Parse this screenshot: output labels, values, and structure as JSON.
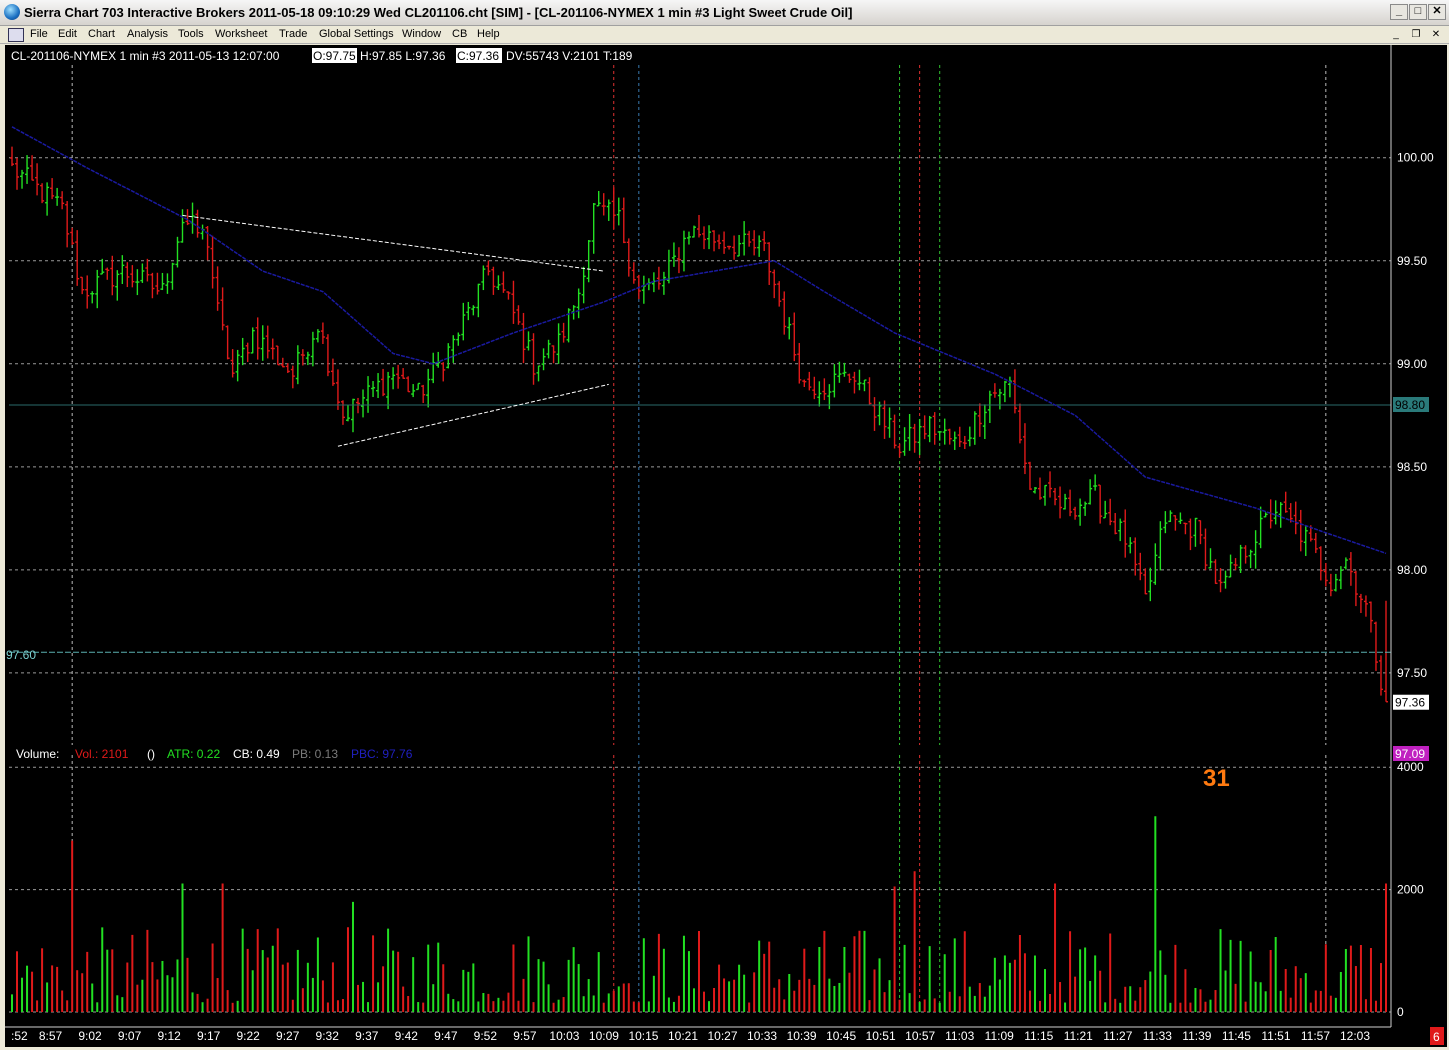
{
  "window": {
    "title": "Sierra Chart 703 Interactive Brokers 2011-05-18  09:10:29  Wed    CL201106.cht [SIM] - [CL-201106-NYMEX  1 min  #3  Light Sweet Crude Oil]",
    "minimize": "_",
    "maximize": "□",
    "close": "✕",
    "doc_minimize": "_",
    "doc_restore": "❐",
    "doc_close": "✕"
  },
  "menu": {
    "items": [
      "File",
      "Edit",
      "Chart",
      "Analysis",
      "Tools",
      "Worksheet",
      "Trade",
      "Global Settings",
      "Window",
      "CB",
      "Help"
    ]
  },
  "chart_header": {
    "symbol": "CL-201106-NYMEX  1 min  #3 2011-05-13 12:07:00",
    "open": "O:97.75",
    "high_low": "H:97.85 L:97.36",
    "close": "C:97.36",
    "stats": "DV:55743 V:2101 T:189"
  },
  "volume_header": {
    "label": "Volume:",
    "vol": "Vol.: 2101",
    "paren": "()",
    "atr": "ATR: 0.22",
    "cb": "CB: 0.49",
    "pb": "PB: 0.13",
    "pbc": "PBC: 97.76"
  },
  "colors": {
    "up_bar": "#22e022",
    "down_bar": "#e01a1a",
    "moving_average": "#1a1aa0",
    "grid": "#9a9a9a",
    "price_marker_bg": "#2a7a7a",
    "last_price_bg": "#ffffff",
    "pbc_marker_bg": "#c020c0",
    "counter_color": "#ff7a10"
  },
  "annotations": {
    "left_price_label": "97.60",
    "counter": "31",
    "bottom_right_badge": "6"
  },
  "chart_data": {
    "type": "candlestick",
    "title": "",
    "price_axis": {
      "ticks": [
        "100.00",
        "99.50",
        "99.00",
        "98.50",
        "98.00",
        "97.50"
      ],
      "range": [
        97.15,
        100.45
      ]
    },
    "price_markers": {
      "horizontal_line": "98.80",
      "last_price": "97.36",
      "pbc": "97.09"
    },
    "volume_axis": {
      "ticks": [
        "4000",
        "2000",
        "0"
      ],
      "range": [
        0,
        4200
      ]
    },
    "time_axis": {
      "ticks": [
        ":52",
        "8:57",
        "9:02",
        "9:07",
        "9:12",
        "9:17",
        "9:22",
        "9:27",
        "9:32",
        "9:37",
        "9:42",
        "9:47",
        "9:52",
        "9:57",
        "10:03",
        "10:09",
        "10:15",
        "10:21",
        "10:27",
        "10:33",
        "10:39",
        "10:45",
        "10:51",
        "10:57",
        "11:03",
        "11:09",
        "11:15",
        "11:21",
        "11:27",
        "11:33",
        "11:39",
        "11:45",
        "11:51",
        "11:57",
        "12:03"
      ]
    },
    "keypoints_close": [
      [
        0,
        99.95
      ],
      [
        10,
        99.75
      ],
      [
        14,
        99.35
      ],
      [
        22,
        99.45
      ],
      [
        30,
        99.35
      ],
      [
        34,
        99.7
      ],
      [
        39,
        99.6
      ],
      [
        41,
        99.25
      ],
      [
        44,
        98.95
      ],
      [
        48,
        99.15
      ],
      [
        56,
        98.95
      ],
      [
        61,
        99.2
      ],
      [
        66,
        98.75
      ],
      [
        71,
        98.85
      ],
      [
        76,
        98.95
      ],
      [
        81,
        98.85
      ],
      [
        88,
        99.1
      ],
      [
        95,
        99.45
      ],
      [
        99,
        99.3
      ],
      [
        104,
        99.0
      ],
      [
        109,
        99.1
      ],
      [
        113,
        99.35
      ],
      [
        116,
        99.75
      ],
      [
        121,
        99.7
      ],
      [
        125,
        99.35
      ],
      [
        130,
        99.4
      ],
      [
        135,
        99.65
      ],
      [
        141,
        99.6
      ],
      [
        150,
        99.55
      ],
      [
        158,
        98.9
      ],
      [
        162,
        98.9
      ],
      [
        168,
        98.95
      ],
      [
        173,
        98.75
      ],
      [
        177,
        98.6
      ],
      [
        183,
        98.7
      ],
      [
        189,
        98.6
      ],
      [
        195,
        98.85
      ],
      [
        199,
        98.9
      ],
      [
        203,
        98.4
      ],
      [
        210,
        98.3
      ],
      [
        216,
        98.35
      ],
      [
        222,
        98.15
      ],
      [
        226,
        97.85
      ],
      [
        230,
        98.25
      ],
      [
        236,
        98.2
      ],
      [
        241,
        97.9
      ],
      [
        246,
        98.1
      ],
      [
        252,
        98.3
      ],
      [
        258,
        98.15
      ],
      [
        263,
        97.95
      ],
      [
        266,
        98.05
      ],
      [
        270,
        97.82
      ],
      [
        274,
        97.36
      ]
    ],
    "keypoints_ma": [
      [
        0,
        100.15
      ],
      [
        15,
        99.95
      ],
      [
        35,
        99.7
      ],
      [
        50,
        99.45
      ],
      [
        62,
        99.35
      ],
      [
        76,
        99.05
      ],
      [
        84,
        99.0
      ],
      [
        100,
        99.15
      ],
      [
        118,
        99.3
      ],
      [
        128,
        99.4
      ],
      [
        140,
        99.45
      ],
      [
        152,
        99.5
      ],
      [
        162,
        99.35
      ],
      [
        176,
        99.15
      ],
      [
        196,
        98.95
      ],
      [
        212,
        98.75
      ],
      [
        226,
        98.45
      ],
      [
        248,
        98.3
      ],
      [
        262,
        98.18
      ],
      [
        274,
        98.08
      ]
    ],
    "volume_spikes": [
      [
        12,
        2800
      ],
      [
        34,
        2100
      ],
      [
        42,
        2100
      ],
      [
        68,
        1800
      ],
      [
        176,
        2050
      ],
      [
        180,
        2300
      ],
      [
        208,
        2100
      ],
      [
        228,
        3200
      ],
      [
        274,
        2101
      ]
    ],
    "lines": [
      {
        "kind": "trendline",
        "from": [
          34,
          99.72
        ],
        "to": [
          118,
          99.45
        ]
      },
      {
        "kind": "trendline",
        "from": [
          65,
          98.6
        ],
        "to": [
          119,
          98.9
        ]
      }
    ],
    "vertical_markers": [
      {
        "bar": 120,
        "color": "red"
      },
      {
        "bar": 125,
        "color": "blue"
      },
      {
        "bar": 177,
        "color": "green"
      },
      {
        "bar": 181,
        "color": "red"
      },
      {
        "bar": 185,
        "color": "green"
      },
      {
        "bar": 262,
        "color": "white"
      },
      {
        "bar": 12,
        "color": "white"
      }
    ]
  }
}
